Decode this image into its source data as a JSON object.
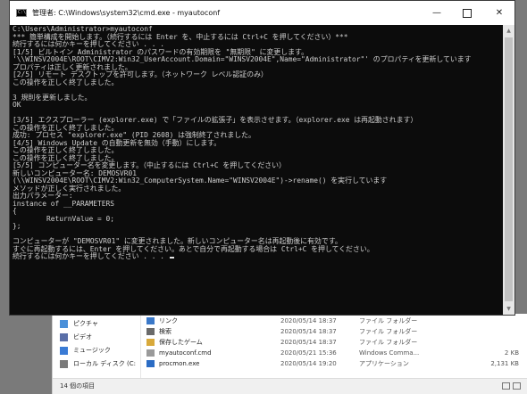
{
  "cmd_window": {
    "title": "管理者: C:\\Windows\\system32\\cmd.exe - myautoconf",
    "icon_label": "C:\\",
    "minimize_glyph": "—",
    "close_glyph": "✕"
  },
  "console": {
    "lines": [
      "C:\\Users\\Administrator>myautoconf",
      "*** 簡単構成を開始します。（続行するには Enter を、中止するには Ctrl+C を押してください）***",
      "続行するには何かキーを押してください . . .",
      "[1/5] ビルトイン Administrator のパスワードの有効期限を \"無期限\" に変更します。",
      "'\\\\WINSV2004E\\ROOT\\CIMV2:Win32_UserAccount.Domain=\"WINSV2004E\",Name=\"Administrator\"' のプロパティを更新しています",
      "プロパティは正しく更新されました。",
      "[2/5] リモート デスクトップを許可します。（ネットワーク レベル認証のみ）",
      "この操作を正しく終了しました。",
      "",
      "3 規則を更新しました。",
      "OK",
      "",
      "[3/5] エクスプローラー (explorer.exe) で「ファイルの拡張子」を表示させます。（explorer.exe は再起動されます）",
      "この操作を正しく終了しました。",
      "成功: プロセス \"explorer.exe\" (PID 2608) は強制終了されました。",
      "[4/5] Windows Update の自動更新を無効（手動）にします。",
      "この操作を正しく終了しました。",
      "この操作を正しく終了しました。",
      "[5/5] コンピューター名を変更します。（中止するには Ctrl+C を押してください）",
      "新しいコンピューター名: DEMOSVR01",
      "(\\\\WINSV2004E\\ROOT\\CIMV2:Win32_ComputerSystem.Name=\"WINSV2004E\")->rename() を実行しています",
      "メソッドが正しく実行されました。",
      "出力パラメーター:",
      "instance of __PARAMETERS",
      "{",
      "        ReturnValue = 0;",
      "};",
      "",
      "コンピューターが \"DEMOSVR01\" に変更されました。新しいコンピューター名は再起動後に有効です。",
      "すぐに再起動するには、Enter を押してください。あとで自分で再起動する場合は Ctrl+C を押してください。",
      "続行するには何かキーを押してください . . . "
    ]
  },
  "explorer": {
    "nav_items": [
      {
        "label": "ピクチャ",
        "icon": "pictures-icon",
        "color": "#4a90d9"
      },
      {
        "label": "ビデオ",
        "icon": "videos-icon",
        "color": "#5a6fa8"
      },
      {
        "label": "ミュージック",
        "icon": "music-icon",
        "color": "#3a7bd5"
      },
      {
        "label": "ローカル ディスク (C:",
        "icon": "disk-icon",
        "color": "#7a7a7a"
      }
    ],
    "files": [
      {
        "name": "リンク",
        "date": "2020/05/14 18:37",
        "type": "ファイル フォルダー",
        "size": "",
        "icon": "link-folder-icon",
        "color": "#3a78c8"
      },
      {
        "name": "検索",
        "date": "2020/05/14 18:37",
        "type": "ファイル フォルダー",
        "size": "",
        "icon": "search-folder-icon",
        "color": "#6a6a6a"
      },
      {
        "name": "保存したゲーム",
        "date": "2020/05/14 18:37",
        "type": "ファイル フォルダー",
        "size": "",
        "icon": "games-folder-icon",
        "color": "#d8a93b"
      },
      {
        "name": "myautoconf.cmd",
        "date": "2020/05/21 15:36",
        "type": "Windows Comma...",
        "size": "2 KB",
        "icon": "cmd-file-icon",
        "color": "#9a9a9a"
      },
      {
        "name": "procmon.exe",
        "date": "2020/05/14 19:20",
        "type": "アプリケーション",
        "size": "2,131 KB",
        "icon": "exe-file-icon",
        "color": "#2b6cc4"
      }
    ],
    "status_text": "14 個の項目"
  }
}
